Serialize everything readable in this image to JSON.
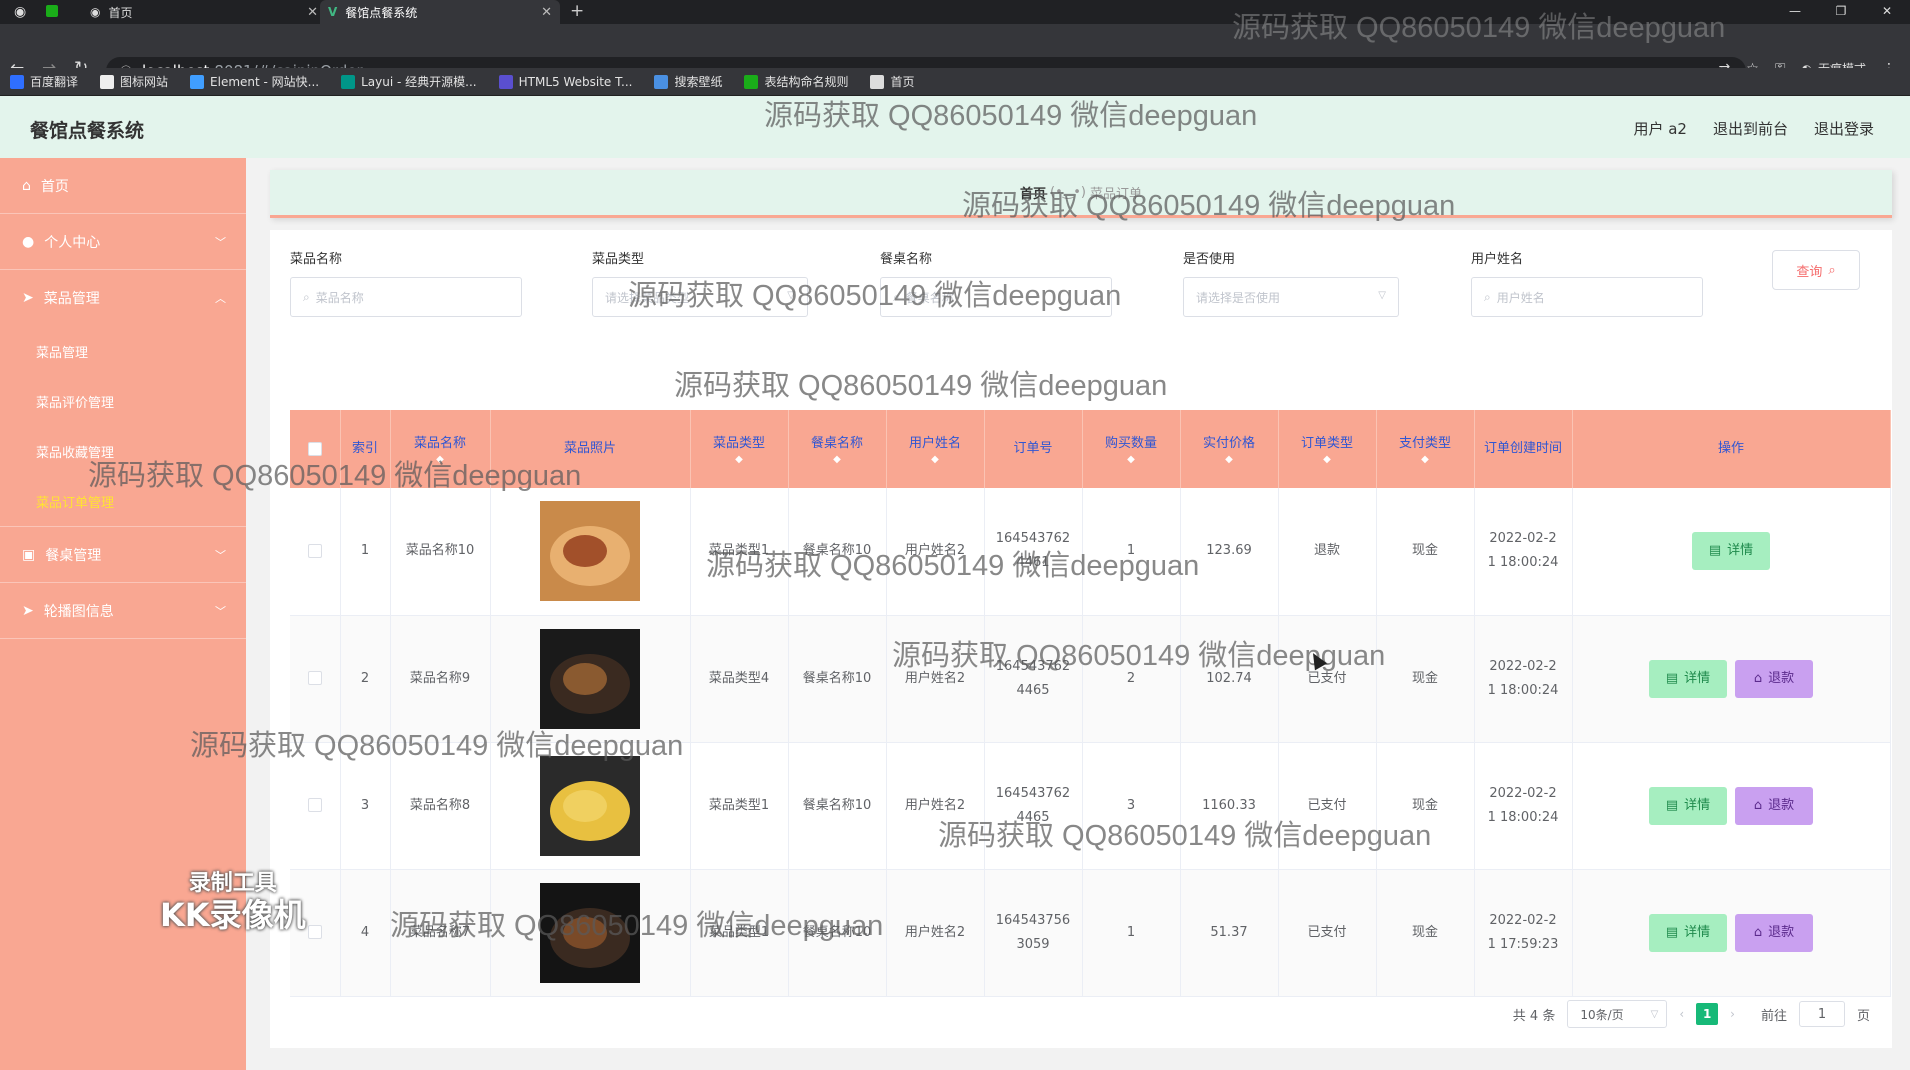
{
  "browser": {
    "tabs": [
      {
        "label": "首页"
      },
      {
        "label": "餐馆点餐系统"
      }
    ],
    "url_host": "localhost",
    "url_rest": ":8081/#/caipinOrder",
    "incognito_label": "无痕模式",
    "bookmarks": [
      {
        "label": "百度翻译",
        "color": "#2f6fff"
      },
      {
        "label": "图标网站",
        "color": "#eeeeee"
      },
      {
        "label": "Element - 网站快...",
        "color": "#409eff"
      },
      {
        "label": "Layui - 经典开源模...",
        "color": "#009688"
      },
      {
        "label": "HTML5 Website T...",
        "color": "#5a4fcf"
      },
      {
        "label": "搜索壁纸",
        "color": "#4a90e2"
      },
      {
        "label": "表结构命名规则",
        "color": "#1aad19"
      },
      {
        "label": "首页",
        "color": "#dddddd"
      }
    ]
  },
  "header": {
    "brand": "餐馆点餐系统",
    "links": [
      "用户 a2",
      "退出到前台",
      "退出登录"
    ]
  },
  "sidebar": {
    "items": [
      {
        "label": "首页",
        "icon": "home-icon",
        "arrow": ""
      },
      {
        "label": "个人中心",
        "icon": "user-icon",
        "arrow": "﹀"
      },
      {
        "label": "菜品管理",
        "icon": "send-icon",
        "arrow": "︿"
      },
      {
        "label": "餐桌管理",
        "icon": "table-icon",
        "arrow": "﹀"
      },
      {
        "label": "轮播图信息",
        "icon": "send-icon",
        "arrow": "﹀"
      }
    ],
    "submenu": [
      "菜品管理",
      "菜品评价管理",
      "菜品收藏管理",
      "菜品订单管理"
    ]
  },
  "breadcrumb": {
    "home": "首页",
    "current": "菜品订单"
  },
  "search": {
    "fields": [
      {
        "label": "菜品名称",
        "placeholder": "菜品名称"
      },
      {
        "label": "菜品类型",
        "placeholder": "请选择菜品类型"
      },
      {
        "label": "餐桌名称",
        "placeholder": "餐桌名称"
      },
      {
        "label": "是否使用",
        "placeholder": "请选择是否使用"
      },
      {
        "label": "用户姓名",
        "placeholder": "用户姓名"
      }
    ],
    "query_label": "查询"
  },
  "table": {
    "headers": [
      "索引",
      "菜品名称",
      "菜品照片",
      "菜品类型",
      "餐桌名称",
      "用户姓名",
      "订单号",
      "购买数量",
      "实付价格",
      "订单类型",
      "支付类型",
      "订单创建时间",
      "操作"
    ],
    "rows": [
      {
        "index": "1",
        "name": "菜品名称10",
        "type": "菜品类型1",
        "table": "餐桌名称10",
        "user": "用户姓名2",
        "order_no": "1645437624461",
        "qty": "1",
        "price": "123.69",
        "order_type": "退款",
        "pay_type": "现金",
        "created": "2022-02-21 18:00:24",
        "can_refund": false
      },
      {
        "index": "2",
        "name": "菜品名称9",
        "type": "菜品类型4",
        "table": "餐桌名称10",
        "user": "用户姓名2",
        "order_no": "1645437624465",
        "qty": "2",
        "price": "102.74",
        "order_type": "已支付",
        "pay_type": "现金",
        "created": "2022-02-21 18:00:24",
        "can_refund": true
      },
      {
        "index": "3",
        "name": "菜品名称8",
        "type": "菜品类型1",
        "table": "餐桌名称10",
        "user": "用户姓名2",
        "order_no": "1645437624465",
        "qty": "3",
        "price": "1160.33",
        "order_type": "已支付",
        "pay_type": "现金",
        "created": "2022-02-21 18:00:24",
        "can_refund": true
      },
      {
        "index": "4",
        "name": "菜品名称7",
        "type": "菜品类型1",
        "table": "餐桌名称10",
        "user": "用户姓名2",
        "order_no": "1645437563059",
        "qty": "1",
        "price": "51.37",
        "order_type": "已支付",
        "pay_type": "现金",
        "created": "2022-02-21 17:59:23",
        "can_refund": true
      }
    ],
    "detail_label": "详情",
    "refund_label": "退款"
  },
  "pagination": {
    "total": "共 4 条",
    "page_size": "10条/页",
    "current_page": "1",
    "goto_label": "前往",
    "goto_value": "1",
    "page_suffix": "页"
  },
  "watermark": "源码获取 QQ86050149 微信deepguan",
  "recorder": {
    "line1": "录制工具",
    "line2": "KK录像机"
  },
  "colors": {
    "accent": "#17b978",
    "sidebar": "#f9a792",
    "header": "#e3f4ec",
    "header_text": "#3056d3"
  }
}
